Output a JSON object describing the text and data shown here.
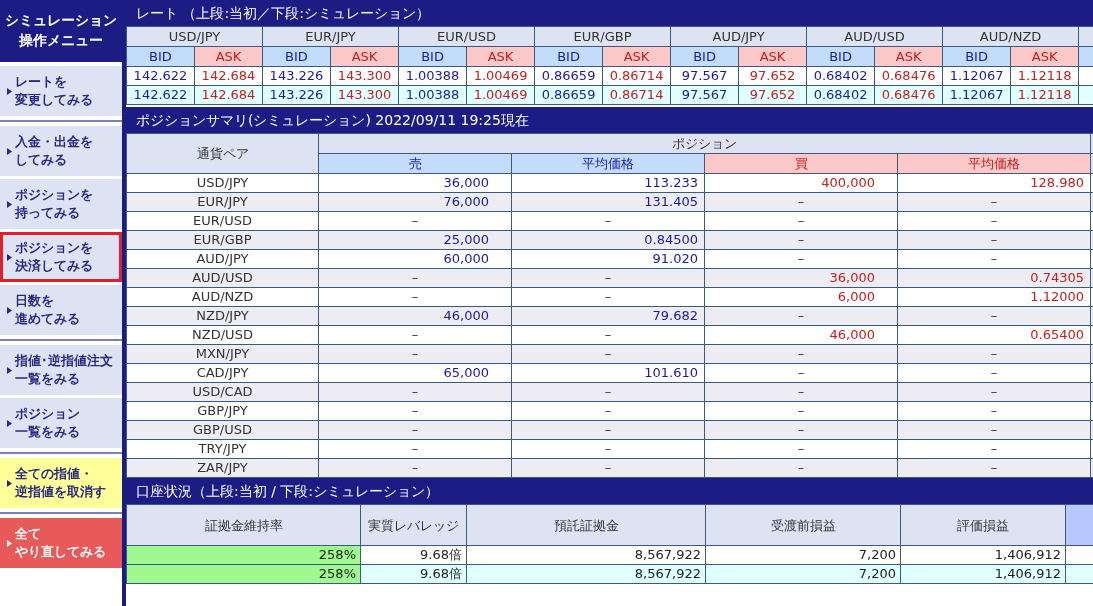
{
  "sidebar": {
    "title": [
      "シミュレーション",
      "操作メニュー"
    ],
    "groups": [
      [
        {
          "lines": [
            "レートを",
            "変更してみる"
          ],
          "kind": "normal",
          "selected": false
        }
      ],
      [
        {
          "lines": [
            "入金・出金を",
            "してみる"
          ],
          "kind": "normal",
          "selected": false
        },
        {
          "lines": [
            "ポジションを",
            "持ってみる"
          ],
          "kind": "normal",
          "selected": false
        },
        {
          "lines": [
            "ポジションを",
            "決済してみる"
          ],
          "kind": "normal",
          "selected": true
        },
        {
          "lines": [
            "日数を",
            "進めてみる"
          ],
          "kind": "normal",
          "selected": false
        }
      ],
      [
        {
          "lines": [
            "指値･逆指値注文",
            "一覧をみる"
          ],
          "kind": "normal",
          "selected": false
        },
        {
          "lines": [
            "ポジション",
            "一覧をみる"
          ],
          "kind": "normal",
          "selected": false
        }
      ],
      [
        {
          "lines": [
            "全ての指値・",
            "逆指値を取消す"
          ],
          "kind": "warning",
          "selected": false
        }
      ],
      [
        {
          "lines": [
            "全て",
            "やり直してみる"
          ],
          "kind": "danger",
          "selected": false
        }
      ]
    ]
  },
  "rates": {
    "title": "レート （上段:当初／下段:シミュレーション）",
    "pairs": [
      {
        "pair": "USD/JPY",
        "bid_label": "BID",
        "ask_label": "ASK",
        "rows": [
          [
            "142.622",
            "142.684"
          ],
          [
            "142.622",
            "142.684"
          ]
        ]
      },
      {
        "pair": "EUR/JPY",
        "bid_label": "BID",
        "ask_label": "ASK",
        "rows": [
          [
            "143.226",
            "143.300"
          ],
          [
            "143.226",
            "143.300"
          ]
        ]
      },
      {
        "pair": "EUR/USD",
        "bid_label": "BID",
        "ask_label": "ASK",
        "rows": [
          [
            "1.00388",
            "1.00469"
          ],
          [
            "1.00388",
            "1.00469"
          ]
        ]
      },
      {
        "pair": "EUR/GBP",
        "bid_label": "BID",
        "ask_label": "ASK",
        "rows": [
          [
            "0.86659",
            "0.86714"
          ],
          [
            "0.86659",
            "0.86714"
          ]
        ]
      },
      {
        "pair": "AUD/JPY",
        "bid_label": "BID",
        "ask_label": "ASK",
        "rows": [
          [
            "97.567",
            "97.652"
          ],
          [
            "97.567",
            "97.652"
          ]
        ]
      },
      {
        "pair": "AUD/USD",
        "bid_label": "BID",
        "ask_label": "ASK",
        "rows": [
          [
            "0.68402",
            "0.68476"
          ],
          [
            "0.68402",
            "0.68476"
          ]
        ]
      },
      {
        "pair": "AUD/NZD",
        "bid_label": "BID",
        "ask_label": "ASK",
        "rows": [
          [
            "1.12067",
            "1.12118"
          ],
          [
            "1.12067",
            "1.12118"
          ]
        ]
      }
    ]
  },
  "positions": {
    "title": "ポジションサマリ(シミュレーション) 2022/09/11 19:25現在",
    "pair_header": "通貨ペア",
    "group_header": "ポジション",
    "columns": [
      {
        "label": "売",
        "kind": "sell"
      },
      {
        "label": "平均価格",
        "kind": "sell"
      },
      {
        "label": "買",
        "kind": "buy"
      },
      {
        "label": "平均価格",
        "kind": "buy"
      }
    ],
    "rows": [
      {
        "pair": "USD/JPY",
        "cells": [
          {
            "v": "36,000",
            "kind": "qty"
          },
          {
            "v": "113.233",
            "kind": "price"
          },
          {
            "v": "400,000",
            "kind": "qty"
          },
          {
            "v": "128.980",
            "kind": "price"
          }
        ]
      },
      {
        "pair": "EUR/JPY",
        "cells": [
          {
            "v": "76,000",
            "kind": "qty"
          },
          {
            "v": "131.405",
            "kind": "price"
          },
          {
            "v": "–",
            "kind": "none"
          },
          {
            "v": "–",
            "kind": "none"
          }
        ]
      },
      {
        "pair": "EUR/USD",
        "cells": [
          {
            "v": "–",
            "kind": "none"
          },
          {
            "v": "–",
            "kind": "none"
          },
          {
            "v": "–",
            "kind": "none"
          },
          {
            "v": "–",
            "kind": "none"
          }
        ]
      },
      {
        "pair": "EUR/GBP",
        "cells": [
          {
            "v": "25,000",
            "kind": "qty"
          },
          {
            "v": "0.84500",
            "kind": "price"
          },
          {
            "v": "–",
            "kind": "none"
          },
          {
            "v": "–",
            "kind": "none"
          }
        ]
      },
      {
        "pair": "AUD/JPY",
        "cells": [
          {
            "v": "60,000",
            "kind": "qty"
          },
          {
            "v": "91.020",
            "kind": "price"
          },
          {
            "v": "–",
            "kind": "none"
          },
          {
            "v": "–",
            "kind": "none"
          }
        ]
      },
      {
        "pair": "AUD/USD",
        "cells": [
          {
            "v": "–",
            "kind": "none"
          },
          {
            "v": "–",
            "kind": "none"
          },
          {
            "v": "36,000",
            "kind": "qty"
          },
          {
            "v": "0.74305",
            "kind": "price"
          }
        ]
      },
      {
        "pair": "AUD/NZD",
        "cells": [
          {
            "v": "–",
            "kind": "none"
          },
          {
            "v": "–",
            "kind": "none"
          },
          {
            "v": "6,000",
            "kind": "qty"
          },
          {
            "v": "1.12000",
            "kind": "price"
          }
        ]
      },
      {
        "pair": "NZD/JPY",
        "cells": [
          {
            "v": "46,000",
            "kind": "qty"
          },
          {
            "v": "79.682",
            "kind": "price"
          },
          {
            "v": "–",
            "kind": "none"
          },
          {
            "v": "–",
            "kind": "none"
          }
        ]
      },
      {
        "pair": "NZD/USD",
        "cells": [
          {
            "v": "–",
            "kind": "none"
          },
          {
            "v": "–",
            "kind": "none"
          },
          {
            "v": "46,000",
            "kind": "qty"
          },
          {
            "v": "0.65400",
            "kind": "price"
          }
        ]
      },
      {
        "pair": "MXN/JPY",
        "cells": [
          {
            "v": "–",
            "kind": "none"
          },
          {
            "v": "–",
            "kind": "none"
          },
          {
            "v": "–",
            "kind": "none"
          },
          {
            "v": "–",
            "kind": "none"
          }
        ]
      },
      {
        "pair": "CAD/JPY",
        "cells": [
          {
            "v": "65,000",
            "kind": "qty"
          },
          {
            "v": "101.610",
            "kind": "price"
          },
          {
            "v": "–",
            "kind": "none"
          },
          {
            "v": "–",
            "kind": "none"
          }
        ]
      },
      {
        "pair": "USD/CAD",
        "cells": [
          {
            "v": "–",
            "kind": "none"
          },
          {
            "v": "–",
            "kind": "none"
          },
          {
            "v": "–",
            "kind": "none"
          },
          {
            "v": "–",
            "kind": "none"
          }
        ]
      },
      {
        "pair": "GBP/JPY",
        "cells": [
          {
            "v": "–",
            "kind": "none"
          },
          {
            "v": "–",
            "kind": "none"
          },
          {
            "v": "–",
            "kind": "none"
          },
          {
            "v": "–",
            "kind": "none"
          }
        ]
      },
      {
        "pair": "GBP/USD",
        "cells": [
          {
            "v": "–",
            "kind": "none"
          },
          {
            "v": "–",
            "kind": "none"
          },
          {
            "v": "–",
            "kind": "none"
          },
          {
            "v": "–",
            "kind": "none"
          }
        ]
      },
      {
        "pair": "TRY/JPY",
        "cells": [
          {
            "v": "–",
            "kind": "none"
          },
          {
            "v": "–",
            "kind": "none"
          },
          {
            "v": "–",
            "kind": "none"
          },
          {
            "v": "–",
            "kind": "none"
          }
        ]
      },
      {
        "pair": "ZAR/JPY",
        "cells": [
          {
            "v": "–",
            "kind": "none"
          },
          {
            "v": "–",
            "kind": "none"
          },
          {
            "v": "–",
            "kind": "none"
          },
          {
            "v": "–",
            "kind": "none"
          }
        ]
      }
    ]
  },
  "account": {
    "title": "口座状況（上段:当初 / 下段:シミュレーション）",
    "columns": [
      "証拠金維持率",
      "実質レバレッジ",
      "預託証拠金",
      "受渡前損益",
      "評価損益"
    ],
    "rows": [
      [
        "258%",
        "9.68倍",
        "8,567,922",
        "7,200",
        "1,406,912"
      ],
      [
        "258%",
        "9.68倍",
        "8,567,922",
        "7,200",
        "1,406,912"
      ]
    ]
  }
}
